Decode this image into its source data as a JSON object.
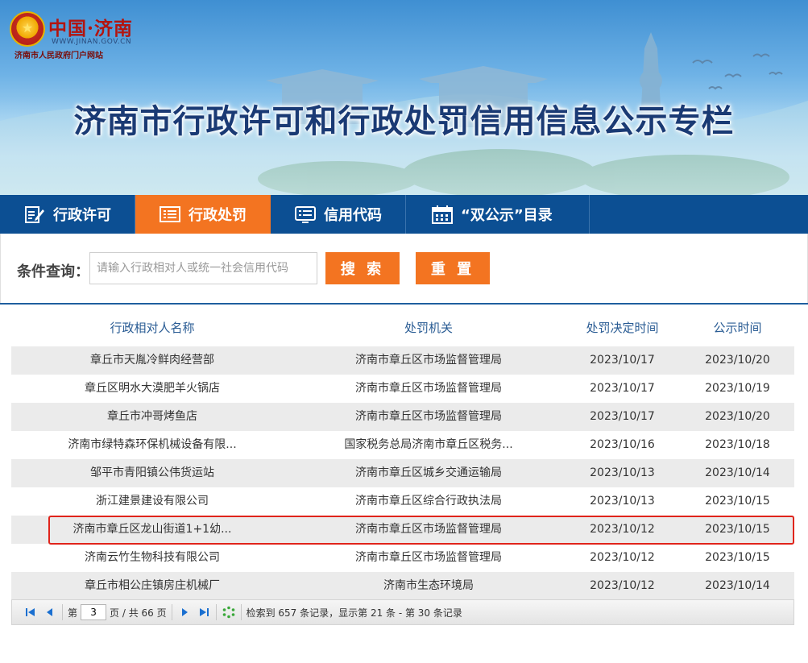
{
  "header": {
    "logo_title": "中国·济南",
    "logo_url": "WWW.JINAN.GOV.CN",
    "logo_subtitle": "济南市人民政府门户网站",
    "banner_title": "济南市行政许可和行政处罚信用信息公示专栏"
  },
  "nav": {
    "items": [
      {
        "label": "行政许可",
        "icon": "edit-document-icon"
      },
      {
        "label": "行政处罚",
        "icon": "list-icon",
        "active": true
      },
      {
        "label": "信用代码",
        "icon": "list-card-icon"
      },
      {
        "label": "“双公示”目录",
        "icon": "calendar-icon"
      }
    ]
  },
  "search": {
    "label": "条件查询：",
    "placeholder": "请输入行政相对人或统一社会信用代码",
    "search_label": "搜 索",
    "reset_label": "重 置"
  },
  "table": {
    "headers": [
      "行政相对人名称",
      "处罚机关",
      "处罚决定时间",
      "公示时间"
    ],
    "rows": [
      [
        "章丘市天胤冷鲜肉经营部",
        "济南市章丘区市场监督管理局",
        "2023/10/17",
        "2023/10/20"
      ],
      [
        "章丘区明水大漠肥羊火锅店",
        "济南市章丘区市场监督管理局",
        "2023/10/17",
        "2023/10/19"
      ],
      [
        "章丘市冲哥烤鱼店",
        "济南市章丘区市场监督管理局",
        "2023/10/17",
        "2023/10/20"
      ],
      [
        "济南市绿特森环保机械设备有限...",
        "国家税务总局济南市章丘区税务...",
        "2023/10/16",
        "2023/10/18"
      ],
      [
        "邹平市青阳镇公伟货运站",
        "济南市章丘区城乡交通运输局",
        "2023/10/13",
        "2023/10/14"
      ],
      [
        "浙江建景建设有限公司",
        "济南市章丘区综合行政执法局",
        "2023/10/13",
        "2023/10/15"
      ],
      [
        "济南市章丘区龙山街道1+1幼...",
        "济南市章丘区市场监督管理局",
        "2023/10/12",
        "2023/10/15"
      ],
      [
        "济南云竹生物科技有限公司",
        "济南市章丘区市场监督管理局",
        "2023/10/12",
        "2023/10/15"
      ],
      [
        "章丘市相公庄镇房庄机械厂",
        "济南市生态环境局",
        "2023/10/12",
        "2023/10/14"
      ]
    ],
    "highlighted_row": 6
  },
  "pager": {
    "page_prefix": "第",
    "current_page": "3",
    "page_suffix": "页 / 共 66 页",
    "summary": "检索到 657 条记录，显示第 21 条 - 第 30 条记录"
  },
  "colors": {
    "nav_bg": "#0c4f93",
    "accent": "#f37421",
    "highlight_border": "#e0241b"
  }
}
